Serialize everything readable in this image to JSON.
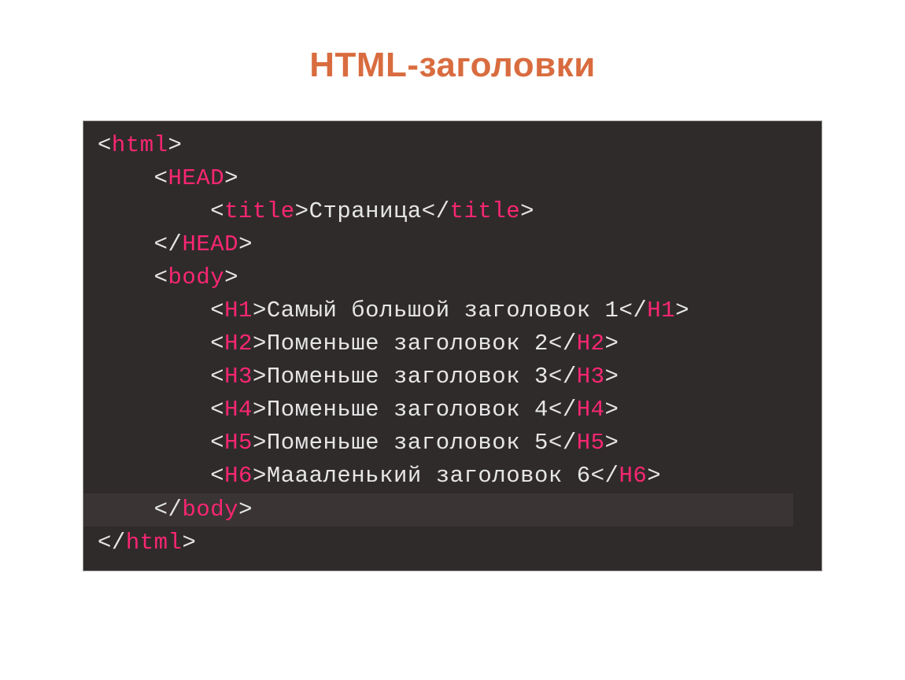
{
  "title": "HTML-заголовки",
  "code": {
    "tags": {
      "html_open": "html",
      "html_close": "html",
      "head_open": "HEAD",
      "head_close": "HEAD",
      "title_open": "title",
      "title_close": "title",
      "body_open": "body",
      "body_close": "body",
      "h1_open": "H1",
      "h1_close": "H1",
      "h2_open": "H2",
      "h2_close": "H2",
      "h3_open": "H3",
      "h3_close": "H3",
      "h4_open": "H4",
      "h4_close": "H4",
      "h5_open": "H5",
      "h5_close": "H5",
      "h6_open": "H6",
      "h6_close": "H6"
    },
    "content": {
      "title_text": "Страница",
      "h1_text": "Самый большой заголовок 1",
      "h2_text": "Поменьше заголовок 2",
      "h3_text": "Поменьше заголовок 3",
      "h4_text": "Поменьше заголовок 4",
      "h5_text": "Поменьше заголовок 5",
      "h6_text": "Маааленький заголовок 6"
    }
  }
}
